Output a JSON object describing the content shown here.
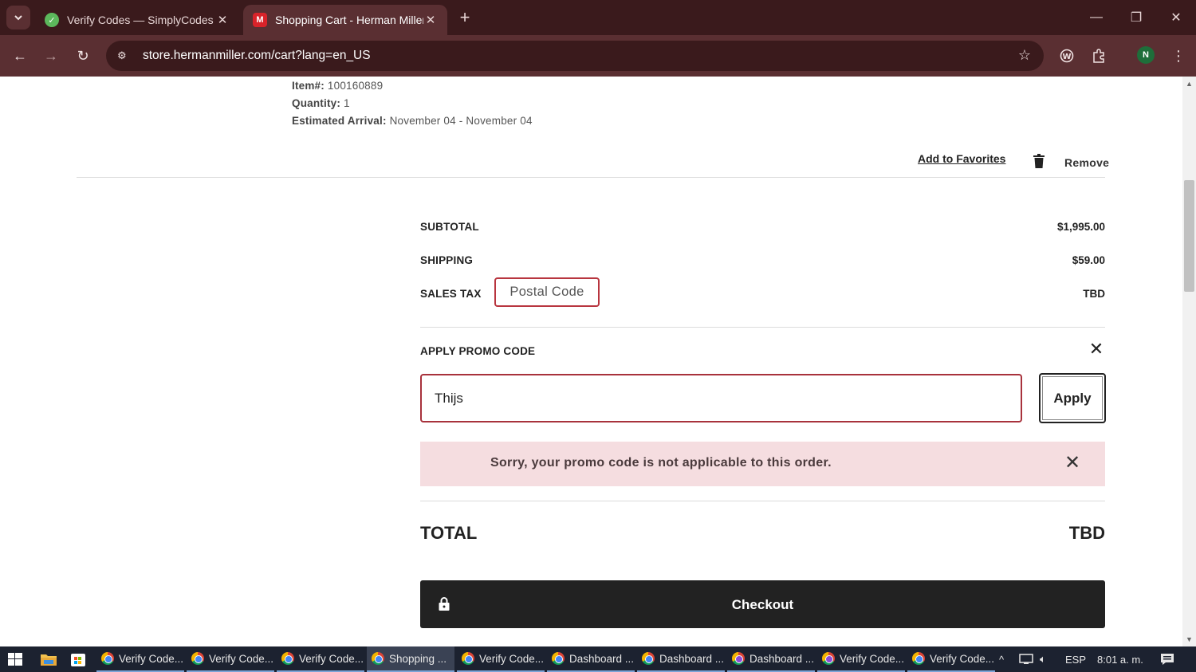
{
  "browser": {
    "tabs": [
      {
        "title": "Verify Codes — SimplyCodes",
        "favicon": "simplycodes-icon",
        "active": false
      },
      {
        "title": "Shopping Cart - Herman Miller",
        "favicon": "hermanmiller-icon",
        "active": true
      }
    ],
    "url": "store.hermanmiller.com/cart?lang=en_US",
    "profile_initial": "N"
  },
  "cart_item": {
    "item_label": "Item#:",
    "item_number": "100160889",
    "quantity_label": "Quantity:",
    "quantity": "1",
    "arrival_label": "Estimated Arrival:",
    "arrival": "November 04 - November 04",
    "add_to_favorites": "Add to Favorites",
    "remove": "Remove"
  },
  "summary": {
    "subtotal_label": "SUBTOTAL",
    "subtotal": "$1,995.00",
    "shipping_label": "SHIPPING",
    "shipping": "$59.00",
    "sales_tax_label": "SALES TAX",
    "postal_code_button": "Postal Code",
    "sales_tax": "TBD"
  },
  "promo": {
    "title": "APPLY PROMO CODE",
    "input_value": "Thijs",
    "apply_label": "Apply",
    "error_message": "Sorry, your promo code is not applicable to this order."
  },
  "total": {
    "label": "TOTAL",
    "value": "TBD"
  },
  "checkout": {
    "label": "Checkout"
  },
  "taskbar": {
    "tasks": [
      {
        "name": "Verify Code...",
        "active": false,
        "icon": "chrome-icon"
      },
      {
        "name": "Verify Code...",
        "active": false,
        "icon": "chrome-icon"
      },
      {
        "name": "Verify Code...",
        "active": false,
        "icon": "chrome-icon"
      },
      {
        "name": "Shopping ...",
        "active": true,
        "icon": "chrome-icon"
      },
      {
        "name": "Verify Code...",
        "active": false,
        "icon": "chrome-icon"
      },
      {
        "name": "Dashboard ...",
        "active": false,
        "icon": "chrome-icon"
      },
      {
        "name": "Dashboard ...",
        "active": false,
        "icon": "chrome-icon"
      },
      {
        "name": "Dashboard ...",
        "active": false,
        "icon": "chrome-purple-icon"
      },
      {
        "name": "Verify Code...",
        "active": false,
        "icon": "chrome-purple-icon"
      },
      {
        "name": "Verify Code...",
        "active": false,
        "icon": "chrome-icon"
      }
    ],
    "language": "ESP",
    "time": "8:01 a. m."
  },
  "colors": {
    "chrome_dark": "#3a1a1c",
    "chrome_toolbar": "#5a2f32",
    "accent_red": "#b8353f",
    "error_bg": "#f5dde0",
    "checkout_bg": "#222222"
  }
}
